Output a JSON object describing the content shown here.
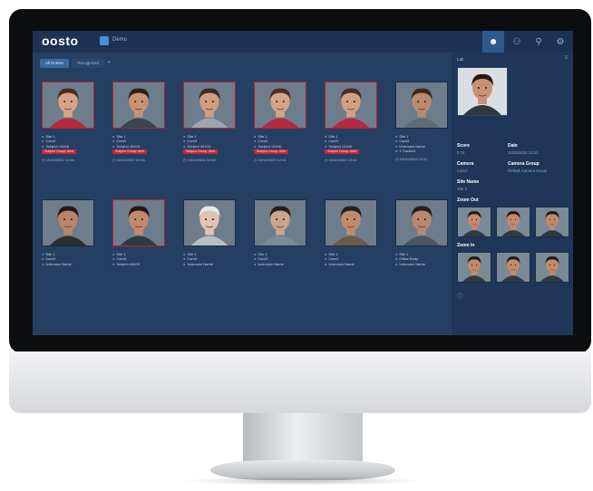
{
  "app": {
    "logo": "oosto",
    "workspace": "Demo",
    "nav_icons": [
      "face-icon",
      "people-icon",
      "search-icon",
      "gear-icon"
    ]
  },
  "tabs": [
    {
      "label": "All Entries",
      "active": true
    },
    {
      "label": "Recognized",
      "active": false
    }
  ],
  "detections": [
    {
      "lines": [
        "Site 1",
        "Cam3",
        "Subject 13166"
      ],
      "badge": "Subject Group: Alert",
      "time": "10/10/2022 12:46",
      "alert": true,
      "skin": "#d8a487",
      "hair": "#4a2c22",
      "shirt": "#b52a3e"
    },
    {
      "lines": [
        "Site 1",
        "Cam3",
        "Subject 45103"
      ],
      "badge": "Subject Group: Alert",
      "time": "10/10/2022 12:46",
      "alert": true,
      "skin": "#c99274",
      "hair": "#2a1d16",
      "shirt": "#36474f"
    },
    {
      "lines": [
        "Site 1",
        "Cam3",
        "Subject 45103"
      ],
      "badge": "Subject Group: Alert",
      "time": "10/10/2022 12:46",
      "alert": true,
      "skin": "#cf9d80",
      "hair": "#3a2a20",
      "shirt": "#9aa7ad"
    },
    {
      "lines": [
        "Site 1",
        "Cam3",
        "Subject 13166"
      ],
      "badge": "Subject Group: Alert",
      "time": "10/10/2022 12:41",
      "alert": true,
      "skin": "#d5a388",
      "hair": "#4d2e22",
      "shirt": "#b52a3e"
    },
    {
      "lines": [
        "Site 1",
        "Cam3",
        "Subject 13166"
      ],
      "badge": "Subject Group: Alert",
      "time": "10/10/2022 12:41",
      "alert": true,
      "skin": "#d4a084",
      "hair": "#4a2c22",
      "shirt": "#b52a3e"
    },
    {
      "lines": [
        "Site 1",
        "Cam3",
        "Unknown Name",
        "1 Tracked"
      ],
      "badge": "",
      "time": "10/10/2022 12:41",
      "alert": false,
      "skin": "#b88a72",
      "hair": "#3a2a20",
      "shirt": "#5f6c73"
    },
    {
      "lines": [
        "Site 1",
        "Cam3",
        "Unknown Name"
      ],
      "badge": "",
      "time": "",
      "alert": false,
      "skin": "#b98467",
      "hair": "#231812",
      "shirt": "#2a2f33"
    },
    {
      "lines": [
        "Site 1",
        "Cam3",
        "Subject 45103"
      ],
      "badge": "",
      "time": "",
      "alert": true,
      "skin": "#c4896d",
      "hair": "#211711",
      "shirt": "#2e3a40"
    },
    {
      "lines": [
        "Site 1",
        "Cam3",
        "Unknown Name"
      ],
      "badge": "",
      "time": "",
      "alert": false,
      "skin": "#e1c3b2",
      "hair": "#e8e8e8",
      "shirt": "#b9c0c4"
    },
    {
      "lines": [
        "Site 1",
        "Cam3",
        "Unknown Name"
      ],
      "badge": "",
      "time": "",
      "alert": false,
      "skin": "#caa48c",
      "hair": "#2a1d16",
      "shirt": "#7b8b99"
    },
    {
      "lines": [
        "Site 1",
        "Cam3",
        "Unknown Name"
      ],
      "badge": "",
      "time": "",
      "alert": false,
      "skin": "#bf8a6e",
      "hair": "#2a1d16",
      "shirt": "#6a5a48"
    },
    {
      "lines": [
        "Site 1",
        "Office Body",
        "Unknown Name"
      ],
      "badge": "",
      "time": "",
      "alert": false,
      "skin": "#b58a70",
      "hair": "#2a1d16",
      "shirt": "#4b5560"
    }
  ],
  "panel": {
    "title": "Lab",
    "fields": [
      {
        "label": "Score",
        "value": "0.74"
      },
      {
        "label": "Date",
        "value": "10/10/2022 12:41"
      },
      {
        "label": "Camera",
        "value": "Cam3"
      },
      {
        "label": "Camera Group",
        "value": "Default Camera Group"
      },
      {
        "label": "Site Name",
        "value": "Site 1"
      }
    ],
    "zoom_out_label": "Zoom Out",
    "zoom_in_label": "Zoom In"
  }
}
